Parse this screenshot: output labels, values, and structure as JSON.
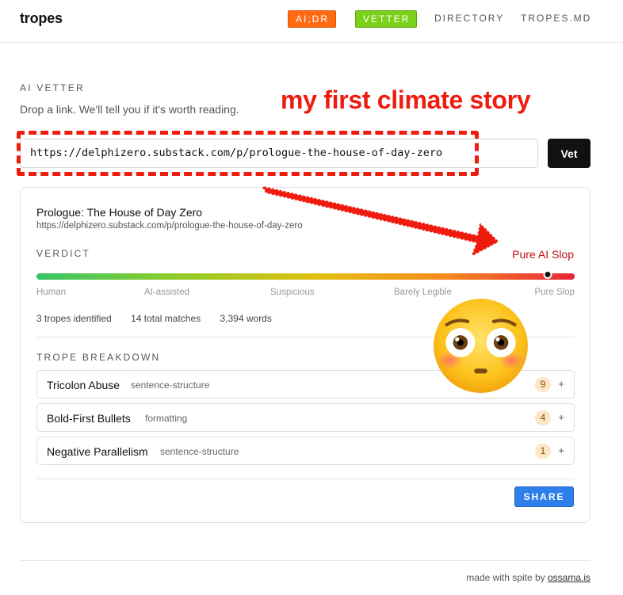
{
  "header": {
    "brand": "tropes",
    "nav": [
      {
        "label": "AI;DR"
      },
      {
        "label": "VETTER"
      },
      {
        "label": "DIRECTORY"
      },
      {
        "label": "TROPES.MD"
      }
    ]
  },
  "intro": {
    "eyebrow": "AI VETTER",
    "subtitle": "Drop a link. We'll tell you if it's worth reading."
  },
  "annotation": {
    "title": "my first climate story",
    "color": "#ee1c0f",
    "emoji": "flushed-face"
  },
  "search": {
    "value": "https://delphizero.substack.com/p/prologue-the-house-of-day-zero",
    "button_label": "Vet"
  },
  "result": {
    "title": "Prologue: The House of Day Zero",
    "url": "https://delphizero.substack.com/p/prologue-the-house-of-day-zero",
    "verdict_label": "VERDICT",
    "verdict": "Pure AI Slop",
    "verdict_color": "#c41010",
    "scale_position": 0.95,
    "scale_labels": [
      "Human",
      "AI-assisted",
      "Suspicious",
      "Barely Legible",
      "Pure Slop"
    ],
    "stats": {
      "tropes": "3 tropes identified",
      "matches": "14 total matches",
      "words": "3,394 words"
    },
    "breakdown_label": "TROPE BREAKDOWN",
    "tropes": [
      {
        "name": "Tricolon Abuse",
        "category": "sentence-structure",
        "count": "9",
        "expand": "+"
      },
      {
        "name": "Bold-First Bullets",
        "category": "formatting",
        "count": "4",
        "expand": "+"
      },
      {
        "name": "Negative Parallelism",
        "category": "sentence-structure",
        "count": "1",
        "expand": "+"
      }
    ],
    "share_label": "SHARE"
  },
  "footer": {
    "text": "made with spite by",
    "link": "ossama.is"
  }
}
